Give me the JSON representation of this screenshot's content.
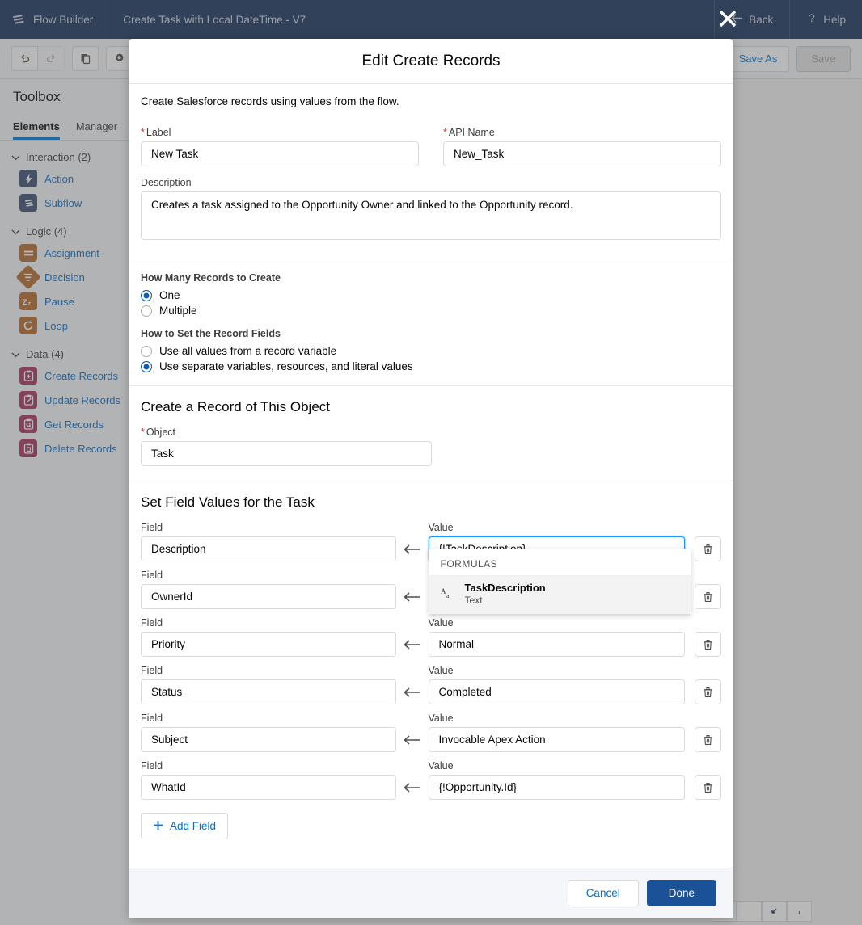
{
  "topbar": {
    "brand": "Flow Builder",
    "brand_icon": "flow-waves-icon",
    "flow_title": "Create Task with Local DateTime - V7",
    "back_label": "Back",
    "back_icon": "arrow-left-icon",
    "help_label": "Help",
    "help_icon": "question-mark-icon",
    "close_icon": "close-x-icon",
    "background": "#16325c"
  },
  "toolbar": {
    "undo_icon": "undo-icon",
    "redo_icon": "redo-icon",
    "copy_icon": "copy-icon",
    "settings_icon": "gear-icon",
    "save_as_label": "Save As",
    "save_label": "Save",
    "save_disabled": true
  },
  "sidebar": {
    "title": "Toolbox",
    "tabs": [
      {
        "label": "Elements",
        "active": true
      },
      {
        "label": "Manager",
        "active": false
      }
    ],
    "groups": [
      {
        "label": "Interaction (2)",
        "chevron_icon": "chevron-down-icon",
        "items": [
          {
            "label": "Action",
            "icon": "lightning-bolt-icon",
            "color": "#3a4f6e"
          },
          {
            "label": "Subflow",
            "icon": "flow-waves-icon",
            "color": "#3a4f6e"
          }
        ]
      },
      {
        "label": "Logic (4)",
        "chevron_icon": "chevron-down-icon",
        "items": [
          {
            "label": "Assignment",
            "icon": "equals-icon",
            "color": "#b46a2b"
          },
          {
            "label": "Decision",
            "icon": "decision-diamond-icon",
            "color": "#b46a2b"
          },
          {
            "label": "Pause",
            "icon": "sleep-zz-icon",
            "color": "#b46a2b"
          },
          {
            "label": "Loop",
            "icon": "loop-refresh-icon",
            "color": "#b46a2b"
          }
        ]
      },
      {
        "label": "Data (4)",
        "chevron_icon": "chevron-down-icon",
        "items": [
          {
            "label": "Create Records",
            "icon": "clipboard-plus-icon",
            "color": "#a5355e"
          },
          {
            "label": "Update Records",
            "icon": "clipboard-pencil-icon",
            "color": "#a5355e"
          },
          {
            "label": "Get Records",
            "icon": "clipboard-search-icon",
            "color": "#a5355e"
          },
          {
            "label": "Delete Records",
            "icon": "clipboard-trash-icon",
            "color": "#a5355e"
          }
        ]
      }
    ]
  },
  "modal": {
    "title": "Edit Create Records",
    "intro": "Create Salesforce records using values from the flow.",
    "label_field": {
      "label": "Label",
      "required": true,
      "value": "New Task"
    },
    "api_name_field": {
      "label": "API Name",
      "required": true,
      "value": "New_Task"
    },
    "description_field": {
      "label": "Description",
      "value": "Creates a task assigned to the Opportunity Owner and linked to the Opportunity record."
    },
    "how_many": {
      "label": "How Many Records to Create",
      "options": [
        {
          "label": "One",
          "selected": true
        },
        {
          "label": "Multiple",
          "selected": false
        }
      ]
    },
    "how_to_set": {
      "label": "How to Set the Record Fields",
      "options": [
        {
          "label": "Use all values from a record variable",
          "selected": false
        },
        {
          "label": "Use separate variables, resources, and literal values",
          "selected": true
        }
      ]
    },
    "object_section": {
      "heading": "Create a Record of This Object",
      "object_label": "Object",
      "object_required": true,
      "object_value": "Task"
    },
    "field_values_section": {
      "heading": "Set Field Values for the Task",
      "field_col_label": "Field",
      "value_col_label": "Value",
      "arrow_icon": "arrow-left-icon",
      "delete_icon": "trash-icon",
      "rows": [
        {
          "field": "Description",
          "value": "{!TaskDescription}",
          "focused": true
        },
        {
          "field": "OwnerId",
          "value": "",
          "focused": false
        },
        {
          "field": "Priority",
          "value": "Normal",
          "focused": false
        },
        {
          "field": "Status",
          "value": "Completed",
          "focused": false
        },
        {
          "field": "Subject",
          "value": "Invocable Apex Action",
          "focused": false
        },
        {
          "field": "WhatId",
          "value": "{!Opportunity.Id}",
          "focused": false
        }
      ],
      "add_field_label": "Add Field",
      "add_field_icon": "plus-icon"
    },
    "dropdown": {
      "visible": true,
      "group_header": "FORMULAS",
      "items": [
        {
          "name": "TaskDescription",
          "type": "Text",
          "icon": "text-Aa-icon",
          "highlighted": true
        }
      ]
    },
    "footer": {
      "cancel_label": "Cancel",
      "done_label": "Done"
    }
  },
  "colors": {
    "brand_navy": "#16325c",
    "link_blue": "#0070d2",
    "primary_blue": "#1b5297",
    "focus_blue": "#1b96ff",
    "required_red": "#c23934"
  }
}
